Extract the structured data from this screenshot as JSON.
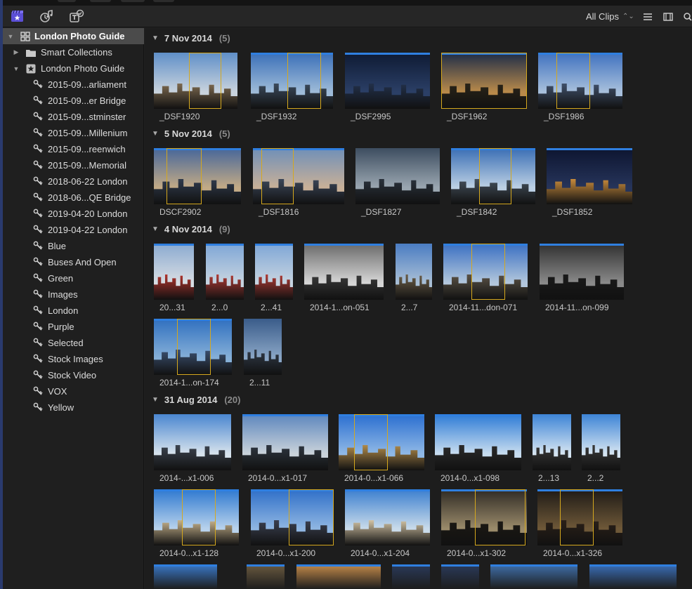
{
  "toolbar": {
    "icons": [
      "libraries-icon",
      "photos-audio-icon",
      "titles-generators-icon"
    ],
    "filter_label": "All Clips",
    "right_icons": [
      "filmstrip-toggle-icon",
      "clip-appearance-icon",
      "search-icon"
    ]
  },
  "sidebar": {
    "library": "London Photo Guide",
    "smart_collections": "Smart Collections",
    "event": "London Photo Guide",
    "keywords": [
      "2015-09...arliament",
      "2015-09...er Bridge",
      "2015-09...stminster",
      "2015-09...Millenium",
      "2015-09...reenwich",
      "2015-09...Memorial",
      "2018-06-22 London",
      "2018-06...QE Bridge",
      "2019-04-20 London",
      "2019-04-22 London",
      "Blue",
      "Buses And Open",
      "Green",
      "Images",
      "London",
      "Purple",
      "Selected",
      "Stock Images",
      "Stock Video",
      "VOX",
      "Yellow"
    ]
  },
  "browser": {
    "groups": [
      {
        "date": "7 Nov 2014",
        "count": "(5)",
        "clips": [
          "_DSF1920",
          "_DSF1932",
          "_DSF2995",
          "_DSF1962",
          "_DSF1986"
        ]
      },
      {
        "date": "5 Nov 2014",
        "count": "(5)",
        "clips": [
          "DSCF2902",
          "_DSF1816",
          "_DSF1827",
          "_DSF1842",
          "_DSF1852"
        ]
      },
      {
        "date": "4 Nov 2014",
        "count": "(9)",
        "clips": [
          "20...31",
          "2...0",
          "2...41",
          "2014-1...on-051",
          "2...7",
          "2014-11...don-071",
          "2014-11...on-099",
          "2014-1...on-174",
          "2...11"
        ]
      },
      {
        "date": "31 Aug 2014",
        "count": "(20)",
        "clips": [
          "2014-...x1-006",
          "2014-0...x1-017",
          "2014-0...x1-066",
          "2014-0...x1-098",
          "2...13",
          "2...2",
          "2014-0...x1-128",
          "2014-0...x1-200",
          "2014-0...x1-204",
          "2014-0...x1-302",
          "2014-0...x1-326"
        ]
      }
    ]
  },
  "colors": {
    "accent_blue": "#2f7fe0",
    "selection_yellow": "#d5a81e",
    "sidebar_selected": "#4b4b4b"
  }
}
